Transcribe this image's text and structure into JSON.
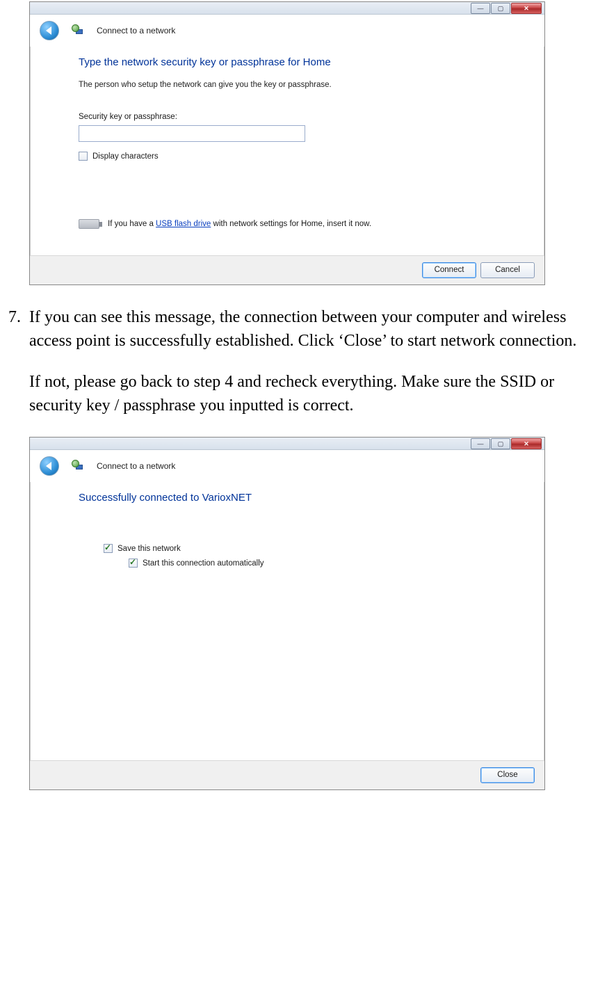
{
  "dialog1": {
    "window_title": "Connect to a network",
    "headline": "Type the network security key or passphrase for Home",
    "subtext": "The person who setup the network can give you the key or passphrase.",
    "input_label": "Security key or passphrase:",
    "input_value": "",
    "display_chars_label": "Display characters",
    "usb_prefix": "If you have a ",
    "usb_link": "USB flash drive",
    "usb_suffix": " with network settings for Home, insert it now.",
    "btn_connect": "Connect",
    "btn_cancel": "Cancel"
  },
  "step": {
    "number": "7.",
    "para1": "If you can see this message, the connection between your computer and wireless access point is successfully established. Click ‘Close’ to start network connection.",
    "para2": "If not, please go back to step 4 and recheck everything. Make sure the SSID or security key / passphrase you inputted is correct."
  },
  "dialog2": {
    "window_title": "Connect to a network",
    "headline": "Successfully connected to VarioxNET",
    "save_label": "Save this network",
    "auto_label": "Start this connection automatically",
    "btn_close": "Close"
  }
}
